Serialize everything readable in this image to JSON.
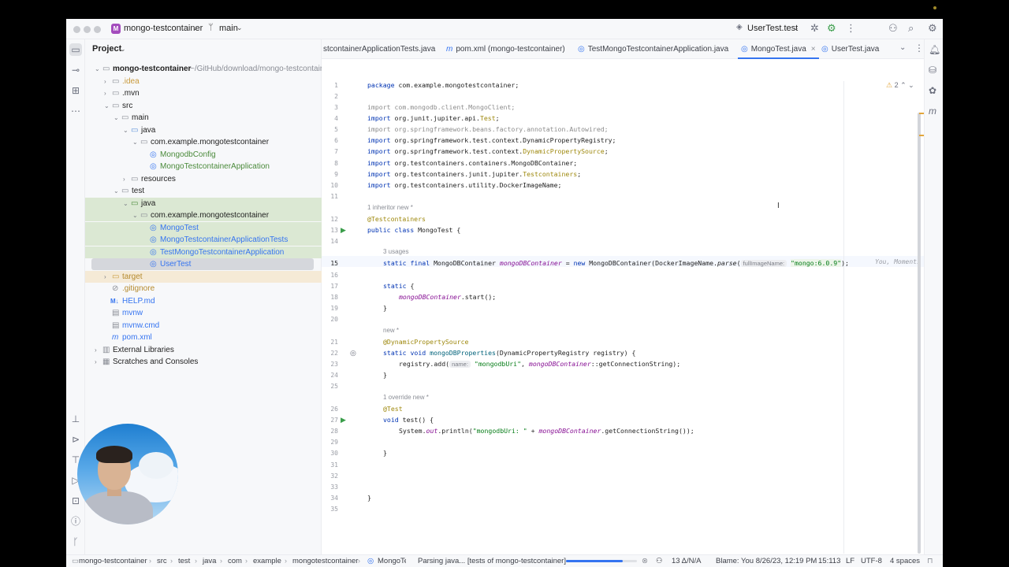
{
  "titlebar": {
    "project_badge": "M",
    "project_name": "mongo-testcontainer",
    "branch": "main",
    "run_config": "UserTest.test"
  },
  "project_panel": {
    "title": "Project",
    "tree": [
      {
        "label": "mongo-testcontainer",
        "suffix": "~/GitHub/download/mongo-testcontainer"
      },
      {
        "label": ".idea"
      },
      {
        "label": ".mvn"
      },
      {
        "label": "src"
      },
      {
        "label": "main"
      },
      {
        "label": "java"
      },
      {
        "label": "com.example.mongotestcontainer"
      },
      {
        "label": "MongodbConfig"
      },
      {
        "label": "MongoTestcontainerApplication"
      },
      {
        "label": "resources"
      },
      {
        "label": "test"
      },
      {
        "label": "java"
      },
      {
        "label": "com.example.mongotestcontainer"
      },
      {
        "label": "MongoTest"
      },
      {
        "label": "MongoTestcontainerApplicationTests"
      },
      {
        "label": "TestMongoTestcontainerApplication"
      },
      {
        "label": "UserTest"
      },
      {
        "label": "target"
      },
      {
        "label": ".gitignore"
      },
      {
        "label": "HELP.md"
      },
      {
        "label": "mvnw"
      },
      {
        "label": "mvnw.cmd"
      },
      {
        "label": "pom.xml"
      },
      {
        "label": "External Libraries"
      },
      {
        "label": "Scratches and Consoles"
      }
    ]
  },
  "tabs": [
    {
      "label": "stcontainerApplicationTests.java",
      "icon": "m"
    },
    {
      "label": "pom.xml (mongo-testcontainer)",
      "icon": "m"
    },
    {
      "label": "TestMongoTestcontainerApplication.java",
      "icon": "c"
    },
    {
      "label": "MongoTest.java",
      "icon": "c",
      "active": true
    },
    {
      "label": "UserTest.java",
      "icon": "c"
    }
  ],
  "editor": {
    "warnings": "2",
    "line_numbers": [
      "1",
      "2",
      "3",
      "4",
      "5",
      "6",
      "7",
      "8",
      "9",
      "10",
      "11",
      "12",
      "13",
      "14",
      "15",
      "16",
      "17",
      "18",
      "19",
      "20",
      "21",
      "22",
      "23",
      "24",
      "25",
      "26",
      "27",
      "28",
      "29",
      "30",
      "31",
      "32",
      "33",
      "34",
      "35"
    ],
    "code": {
      "l1_kw": "package",
      "l1": " com.example.mongotestcontainer;",
      "l3": "import com.mongodb.client.MongoClient;",
      "l4_kw": "import",
      "l4": " org.junit.jupiter.api.",
      "l4_t": "Test",
      "l4_e": ";",
      "l5": "import org.springframework.beans.factory.annotation.Autowired;",
      "l6_kw": "import",
      "l6": " org.springframework.test.context.DynamicPropertyRegistry;",
      "l7_kw": "import",
      "l7": " org.springframework.test.context.",
      "l7_t": "DynamicPropertySource",
      "l7_e": ";",
      "l8_kw": "import",
      "l8": " org.testcontainers.containers.MongoDBContainer;",
      "l9_kw": "import",
      "l9": " org.testcontainers.junit.jupiter.",
      "l9_t": "Testcontainers",
      "l9_e": ";",
      "l10_kw": "import",
      "l10": " org.testcontainers.utility.DockerImageName;",
      "hint12": "1 inheritor   new *",
      "l12": "@Testcontainers",
      "l13_kw": "public class",
      "l13": " MongoTest {",
      "hint15": "3 usages",
      "l15_kw": "static final",
      "l15_a": " MongoDBContainer ",
      "l15_f": "mongoDBContainer",
      "l15_b": " = ",
      "l15_new": "new",
      "l15_c": " MongoDBContainer(DockerImageName.",
      "l15_m": "parse",
      "l15_d": "(",
      "l15_inlay": "fullImageName:",
      "l15_s": "\"mongo:6.0.9\"",
      "l15_e": ");",
      "l17_kw": "static",
      "l17": " {",
      "l18_f": "mongoDBContainer",
      "l18": ".start();",
      "l19": "}",
      "hint21": "new *",
      "l21": "@DynamicPropertySource",
      "l22_kw": "static void",
      "l22_m": " mongoDBProperties",
      "l22": "(DynamicPropertyRegistry registry) {",
      "l23_a": "registry.add(",
      "l23_inlay": "name:",
      "l23_s": "\"mongodbUri\"",
      "l23_b": ", ",
      "l23_f": "mongoDBContainer",
      "l23_c": "::getConnectionString);",
      "l24": "}",
      "hint26": "1 override   new *",
      "l26": "@Test",
      "l27_kw": "void",
      "l27": " test() {",
      "l28_a": "System.",
      "l28_f": "out",
      "l28_b": ".println(",
      "l28_s": "\"mongodbUri: \"",
      "l28_c": " + ",
      "l28_f2": "mongoDBContainer",
      "l28_d": ".getConnectionString());",
      "l30": "}",
      "l34": "}"
    },
    "blame_inline": "You, Moments"
  },
  "status": {
    "breadcrumbs": [
      "mongo-testcontainer",
      "src",
      "test",
      "java",
      "com",
      "example",
      "mongotestcontainer",
      "MongoTe"
    ],
    "task": "Parsing java... [tests of mongo-testcontainer]",
    "progress": 0.8,
    "vcs": "13 Δ/N/A",
    "blame": "Blame: You 8/26/23, 12:19 PM",
    "position": "15:113",
    "line_sep": "LF",
    "encoding": "UTF-8",
    "indent": "4 spaces"
  },
  "colors": {
    "accent": "#3574f0",
    "keyword": "#0033b3",
    "string": "#067d17",
    "field": "#871094",
    "annotation": "#9e880d"
  }
}
